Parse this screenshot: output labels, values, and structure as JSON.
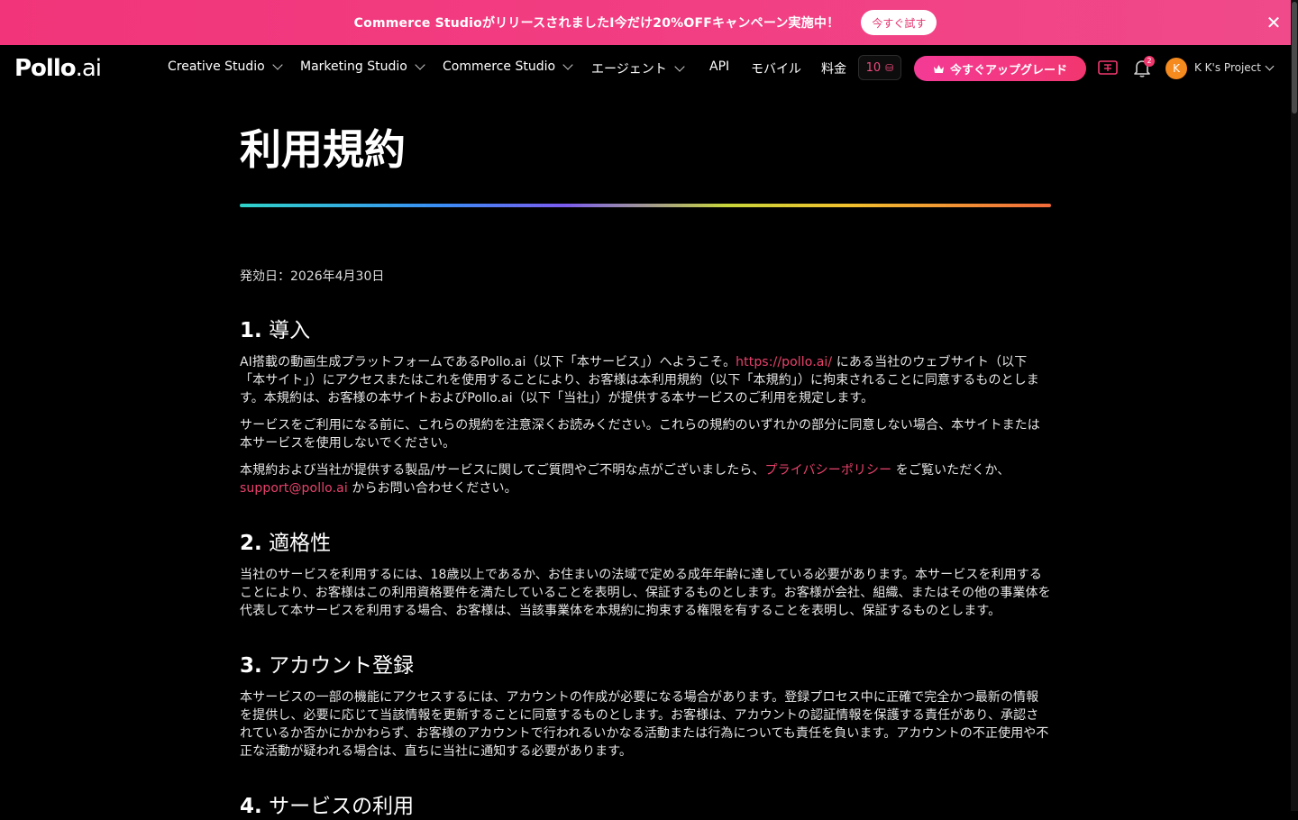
{
  "promo": {
    "text": "Commerce StudioがリリースされましたI今だけ20%OFFキャンペーン実施中！",
    "button": "今すぐ試す",
    "close": "✕"
  },
  "nav": {
    "logo_main": "Pollo",
    "logo_ai": ".ai",
    "items": [
      {
        "label": "Creative Studio"
      },
      {
        "label": "Marketing Studio"
      },
      {
        "label": "Commerce Studio"
      },
      {
        "label": "エージェント"
      },
      {
        "label": "API"
      },
      {
        "label": "モバイル"
      },
      {
        "label": "料金"
      }
    ],
    "credits": "10",
    "upgrade": "今すぐアップグレード",
    "notif_count": "2",
    "avatar_letter": "K",
    "project": "K K's Project"
  },
  "page": {
    "title": "利用規約",
    "effective": "発効日：2026年4月30日",
    "sections": [
      {
        "num": "1.",
        "heading": "導入",
        "p1_a": "AI搭載の動画生成プラットフォームであるPollo.ai（以下「本サービス」）へようこそ。",
        "p1_link": "https://pollo.ai/",
        "p1_b": " にある当社のウェブサイト（以下「本サイト」）にアクセスまたはこれを使用することにより、お客様は本利用規約（以下「本規約」）に拘束されることに同意するものとします。本規約は、お客様の本サイトおよびPollo.ai（以下「当社」）が提供する本サービスのご利用を規定します。",
        "p2": "サービスをご利用になる前に、これらの規約を注意深くお読みください。これらの規約のいずれかの部分に同意しない場合、本サイトまたは本サービスを使用しないでください。",
        "p3_a": "本規約および当社が提供する製品/サービスに関してご質問やご不明な点がございましたら、",
        "p3_link1": "プライバシーポリシー",
        "p3_b": " をご覧いただくか、",
        "p3_link2": "support@pollo.ai",
        "p3_c": " からお問い合わせください。"
      },
      {
        "num": "2.",
        "heading": "適格性",
        "p1": "当社のサービスを利用するには、18歳以上であるか、お住まいの法域で定める成年年齢に達している必要があります。本サービスを利用することにより、お客様はこの利用資格要件を満たしていることを表明し、保証するものとします。お客様が会社、組織、またはその他の事業体を代表して本サービスを利用する場合、お客様は、当該事業体を本規約に拘束する権限を有することを表明し、保証するものとします。"
      },
      {
        "num": "3.",
        "heading": "アカウント登録",
        "p1": "本サービスの一部の機能にアクセスするには、アカウントの作成が必要になる場合があります。登録プロセス中に正確で完全かつ最新の情報を提供し、必要に応じて当該情報を更新することに同意するものとします。お客様は、アカウントの認証情報を保護する責任があり、承認されているか否かにかかわらず、お客様のアカウントで行われるいかなる活動または行為についても責任を負います。アカウントの不正使用や不正な活動が疑われる場合は、直ちに当社に通知する必要があります。"
      },
      {
        "num": "4.",
        "heading": "サービスの利用"
      }
    ]
  }
}
